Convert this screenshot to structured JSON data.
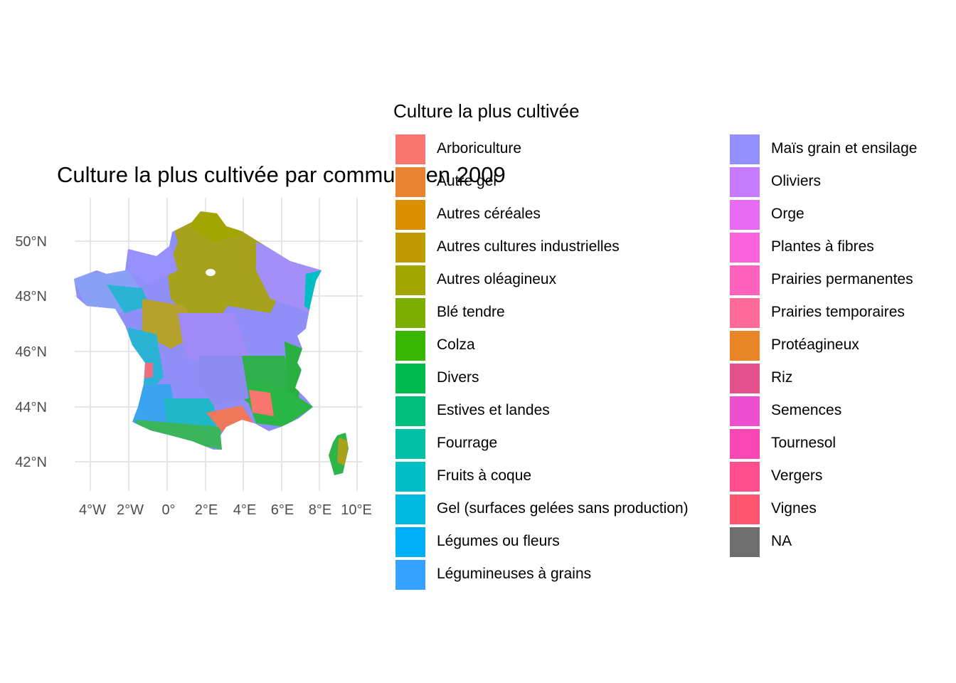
{
  "map": {
    "title": "Culture la plus cultivée par commune en 2009",
    "x_ticks": [
      "4°W",
      "2°W",
      "0°",
      "2°E",
      "4°E",
      "6°E",
      "8°E",
      "10°E"
    ],
    "y_ticks": [
      "50°N",
      "48°N",
      "46°N",
      "44°N",
      "42°N"
    ],
    "grid": true,
    "region": "France (communes)"
  },
  "legend": {
    "title": "Culture la plus cultivée",
    "placement": "right",
    "items": [
      {
        "label": "Arboriculture",
        "color": "#F8766D"
      },
      {
        "label": "Autre gel",
        "color": "#EA8331"
      },
      {
        "label": "Autres céréales",
        "color": "#D89000"
      },
      {
        "label": "Autres cultures industrielles",
        "color": "#C09B00"
      },
      {
        "label": "Autres oléagineux",
        "color": "#A3A500"
      },
      {
        "label": "Blé tendre",
        "color": "#7CAE00"
      },
      {
        "label": "Colza",
        "color": "#39B600"
      },
      {
        "label": "Divers",
        "color": "#00BB4E"
      },
      {
        "label": "Estives et landes",
        "color": "#00BF7D"
      },
      {
        "label": "Fourrage",
        "color": "#00C1A3"
      },
      {
        "label": "Fruits à coque",
        "color": "#00BFC4"
      },
      {
        "label": "Gel (surfaces gelées sans production)",
        "color": "#00BAE0"
      },
      {
        "label": "Légumes ou fleurs",
        "color": "#00B0F6"
      },
      {
        "label": "Légumineuses à grains",
        "color": "#35A2FF"
      },
      {
        "label": "Maïs grain et ensilage",
        "color": "#9590FF"
      },
      {
        "label": "Oliviers",
        "color": "#C77CFF"
      },
      {
        "label": "Orge",
        "color": "#E76BF3"
      },
      {
        "label": "Plantes à fibres",
        "color": "#FA62DB"
      },
      {
        "label": "Prairies permanentes",
        "color": "#FF62BC"
      },
      {
        "label": "Prairies temporaires",
        "color": "#FF6A98"
      },
      {
        "label": "Protéagineux",
        "color": "#E88526"
      },
      {
        "label": "Riz",
        "color": "#E3508C"
      },
      {
        "label": "Semences",
        "color": "#EC4FD0"
      },
      {
        "label": "Tournesol",
        "color": "#F948B5"
      },
      {
        "label": "Vergers",
        "color": "#FF4E8E"
      },
      {
        "label": "Vignes",
        "color": "#FF5670"
      },
      {
        "label": "NA",
        "color": "#6E6E6E"
      }
    ]
  }
}
